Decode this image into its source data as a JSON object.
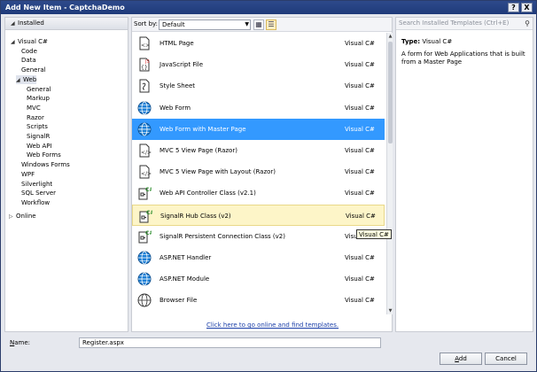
{
  "window": {
    "title": "Add New Item - CaptchaDemo",
    "help_label": "?",
    "close_label": "X"
  },
  "left": {
    "header": "Installed",
    "tree": [
      {
        "label": "Visual C#",
        "arrow": "◢",
        "indent": 0
      },
      {
        "label": "Code",
        "indent": 2
      },
      {
        "label": "Data",
        "indent": 2
      },
      {
        "label": "General",
        "indent": 2
      },
      {
        "label": "Web",
        "arrow": "◢",
        "indent": 1,
        "selected": true
      },
      {
        "label": "General",
        "indent": 3
      },
      {
        "label": "Markup",
        "indent": 3
      },
      {
        "label": "MVC",
        "indent": 3
      },
      {
        "label": "Razor",
        "indent": 3
      },
      {
        "label": "Scripts",
        "indent": 3
      },
      {
        "label": "SignalR",
        "indent": 3
      },
      {
        "label": "Web API",
        "indent": 3
      },
      {
        "label": "Web Forms",
        "indent": 3
      },
      {
        "label": "Windows Forms",
        "indent": 2
      },
      {
        "label": "WPF",
        "indent": 2
      },
      {
        "label": "Silverlight",
        "indent": 2
      },
      {
        "label": "SQL Server",
        "indent": 2
      },
      {
        "label": "Workflow",
        "indent": 2
      }
    ],
    "online": {
      "label": "Online",
      "arrow": "▷"
    }
  },
  "toolbar": {
    "sort_label": "Sort by:",
    "sort_value": "Default"
  },
  "items": [
    {
      "name": "HTML Page",
      "lang": "Visual C#",
      "icon": "html-page-icon"
    },
    {
      "name": "JavaScript File",
      "lang": "Visual C#",
      "icon": "javascript-file-icon"
    },
    {
      "name": "Style Sheet",
      "lang": "Visual C#",
      "icon": "style-sheet-icon"
    },
    {
      "name": "Web Form",
      "lang": "Visual C#",
      "icon": "globe-icon"
    },
    {
      "name": "Web Form with Master Page",
      "lang": "Visual C#",
      "icon": "globe-icon",
      "state": "selected"
    },
    {
      "name": "MVC 5 View Page (Razor)",
      "lang": "Visual C#",
      "icon": "mvc-page-icon"
    },
    {
      "name": "MVC 5 View Page with Layout (Razor)",
      "lang": "Visual C#",
      "icon": "mvc-page-icon"
    },
    {
      "name": "Web API Controller Class (v2.1)",
      "lang": "Visual C#",
      "icon": "csharp-class-icon"
    },
    {
      "name": "SignalR Hub Class (v2)",
      "lang": "Visual C#",
      "icon": "csharp-class-icon",
      "state": "hover"
    },
    {
      "name": "SignalR Persistent Connection Class (v2)",
      "lang": "Visual",
      "icon": "csharp-class-icon"
    },
    {
      "name": "ASP.NET Handler",
      "lang": "Visual C#",
      "icon": "globe-icon"
    },
    {
      "name": "ASP.NET Module",
      "lang": "Visual C#",
      "icon": "globe-icon"
    },
    {
      "name": "Browser File",
      "lang": "Visual C#",
      "icon": "browser-file-icon"
    }
  ],
  "online_link": "Click here to go online and find templates.",
  "tooltip": "Visual C#",
  "search": {
    "placeholder": "Search Installed Templates (Ctrl+E)"
  },
  "details": {
    "type_label": "Type:",
    "type_value": "Visual C#",
    "description": "A form for Web Applications that is built from a Master Page"
  },
  "footer": {
    "name_label": "Name:",
    "name_value": "Register.aspx",
    "add_label": "Add",
    "cancel_label": "Cancel"
  },
  "colors": {
    "selection": "#3399ff",
    "hover": "#fdf5c8",
    "title_bar": "#1f3a7a",
    "link": "#1a3ea8"
  }
}
